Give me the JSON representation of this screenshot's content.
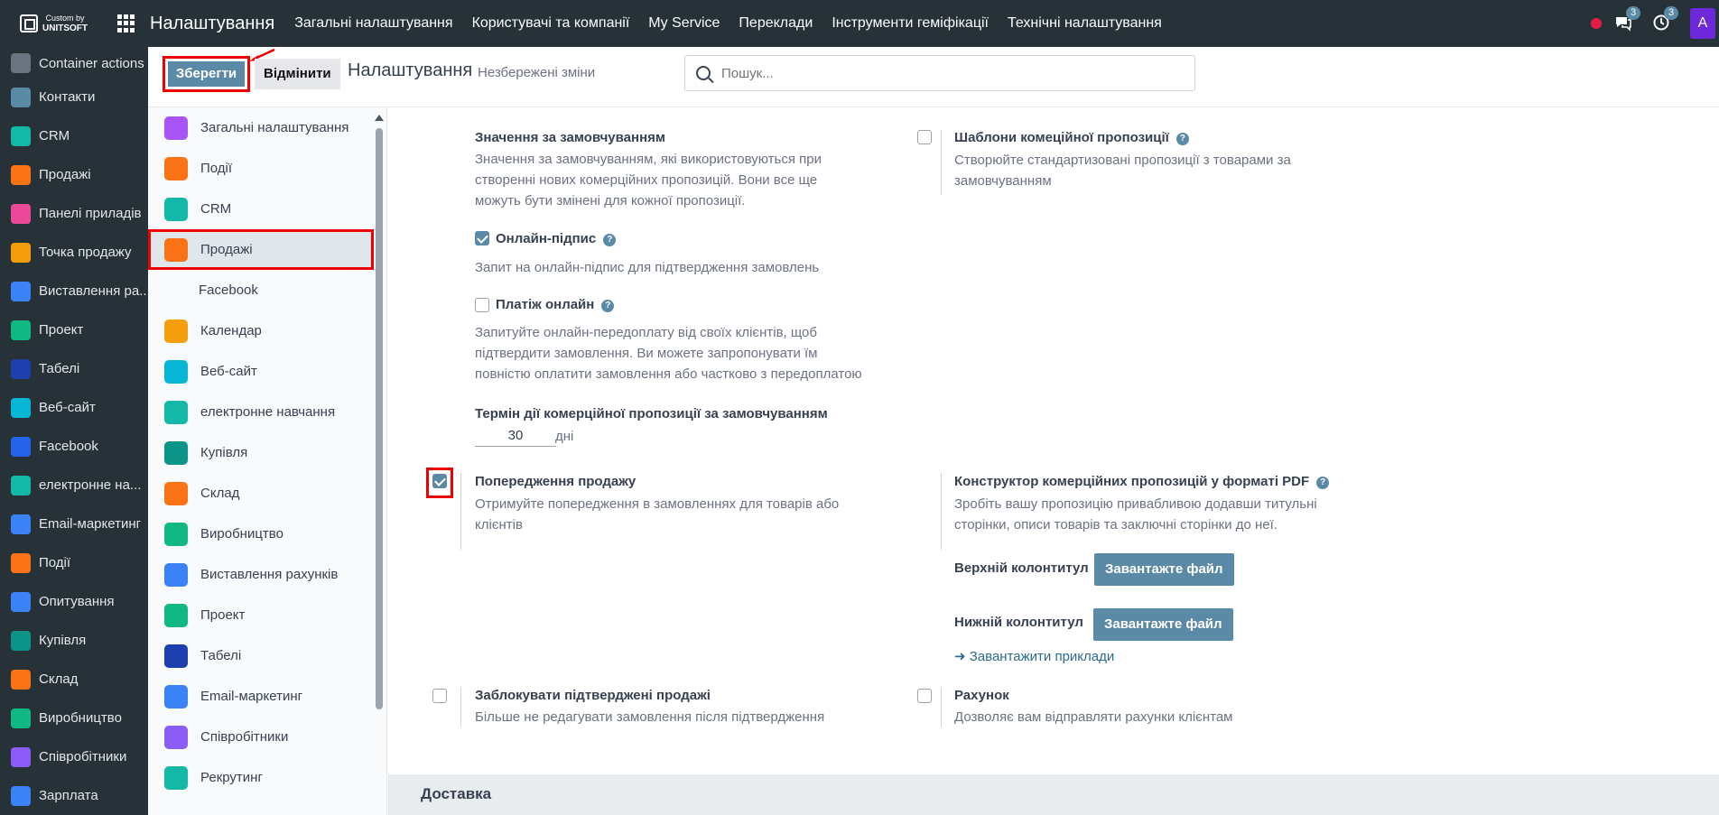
{
  "topbar": {
    "brand_small": "Custom by",
    "brand_name": "UNITSOFT",
    "app_title": "Налаштування",
    "menu": [
      "Загальні налаштування",
      "Користувачі та компанії",
      "My Service",
      "Переклади",
      "Інструменти геміфікації",
      "Технічні налаштування"
    ],
    "chat_badge": "3",
    "activity_badge": "3",
    "avatar_letter": "A"
  },
  "apps_sidebar": [
    {
      "label": "Container actions",
      "icon": "container-icon",
      "color": "#6b7280"
    },
    {
      "label": "Контакти",
      "icon": "contacts-icon",
      "color": "#5b8aa6"
    },
    {
      "label": "CRM",
      "icon": "crm-icon",
      "color": "#14b8a6"
    },
    {
      "label": "Продажі",
      "icon": "sales-icon",
      "color": "#f97316"
    },
    {
      "label": "Панелі приладів",
      "icon": "dashboard-icon",
      "color": "#ec4899"
    },
    {
      "label": "Точка продажу",
      "icon": "pos-icon",
      "color": "#f59e0b"
    },
    {
      "label": "Виставлення ра...",
      "icon": "invoicing-icon",
      "color": "#3b82f6"
    },
    {
      "label": "Проект",
      "icon": "project-icon",
      "color": "#10b981"
    },
    {
      "label": "Табелі",
      "icon": "timesheet-icon",
      "color": "#1e40af"
    },
    {
      "label": "Веб-сайт",
      "icon": "website-icon",
      "color": "#06b6d4"
    },
    {
      "label": "Facebook",
      "icon": "facebook-icon",
      "color": "#2563eb"
    },
    {
      "label": "електронне на...",
      "icon": "elearning-icon",
      "color": "#14b8a6"
    },
    {
      "label": "Email-маркетинг",
      "icon": "email-marketing-icon",
      "color": "#3b82f6"
    },
    {
      "label": "Події",
      "icon": "events-icon",
      "color": "#f97316"
    },
    {
      "label": "Опитування",
      "icon": "survey-icon",
      "color": "#3b82f6"
    },
    {
      "label": "Купівля",
      "icon": "purchase-icon",
      "color": "#0d9488"
    },
    {
      "label": "Склад",
      "icon": "inventory-icon",
      "color": "#f97316"
    },
    {
      "label": "Виробництво",
      "icon": "manufacturing-icon",
      "color": "#10b981"
    },
    {
      "label": "Співробітники",
      "icon": "employees-icon",
      "color": "#8b5cf6"
    },
    {
      "label": "Зарплата",
      "icon": "payroll-icon",
      "color": "#3b82f6"
    }
  ],
  "control": {
    "save_label": "Зберегти",
    "discard_label": "Відмінити",
    "breadcrumb": "Налаштування",
    "unsaved": "Незбережені зміни",
    "search_placeholder": "Пошук..."
  },
  "settings_nav": [
    {
      "label": "Загальні налаштування",
      "icon": "general-settings-icon",
      "color": "#a855f7"
    },
    {
      "label": "Події",
      "icon": "events-icon",
      "color": "#f97316"
    },
    {
      "label": "CRM",
      "icon": "crm-icon",
      "color": "#14b8a6"
    },
    {
      "label": "Продажі",
      "icon": "sales-icon",
      "color": "#f97316",
      "active": true
    },
    {
      "label": "Facebook",
      "icon": "",
      "color": "",
      "sub": true
    },
    {
      "label": "Календар",
      "icon": "calendar-icon",
      "color": "#f59e0b"
    },
    {
      "label": "Веб-сайт",
      "icon": "website-icon",
      "color": "#06b6d4"
    },
    {
      "label": "електронне навчання",
      "icon": "elearning-icon",
      "color": "#14b8a6"
    },
    {
      "label": "Купівля",
      "icon": "purchase-icon",
      "color": "#0d9488"
    },
    {
      "label": "Склад",
      "icon": "inventory-icon",
      "color": "#f97316"
    },
    {
      "label": "Виробництво",
      "icon": "manufacturing-icon",
      "color": "#10b981"
    },
    {
      "label": "Виставлення рахунків",
      "icon": "invoicing-icon",
      "color": "#3b82f6"
    },
    {
      "label": "Проект",
      "icon": "project-icon",
      "color": "#10b981"
    },
    {
      "label": "Табелі",
      "icon": "timesheet-icon",
      "color": "#1e40af"
    },
    {
      "label": "Email-маркетинг",
      "icon": "email-marketing-icon",
      "color": "#3b82f6"
    },
    {
      "label": "Співробітники",
      "icon": "employees-icon",
      "color": "#8b5cf6"
    },
    {
      "label": "Рекрутинг",
      "icon": "recruitment-icon",
      "color": "#14b8a6"
    }
  ],
  "settings": {
    "defaults_title": "Значення за замовчуванням",
    "defaults_desc": [
      "Значення за замовчуванням, які використовуються при",
      "створенні нових комерційних пропозицій. Вони все ще",
      "можуть бути змінені для кожної пропозиції."
    ],
    "online_sign_label": "Онлайн-підпис",
    "online_sign_checked": true,
    "online_sign_desc": "Запит на онлайн-підпис для підтвердження замовлень",
    "online_pay_label": "Платіж онлайн",
    "online_pay_checked": false,
    "online_pay_desc": [
      "Запитуйте онлайн-передоплату від своїх клієнтів, щоб",
      "підтвердити замовлення. Ви можете запропонувати їм",
      "повністю оплатити замовлення або частково з передоплатою"
    ],
    "validity_title": "Термін дії комерційної пропозиції за замовчуванням",
    "validity_value": "30",
    "validity_unit": "дні",
    "templates_title": "Шаблони комеційної пропозиції",
    "templates_checked": false,
    "templates_desc": [
      "Створюйте стандартизовані пропозиції з товарами за",
      "замовчуванням"
    ],
    "warnings_title": "Попередження продажу",
    "warnings_checked": true,
    "warnings_desc": [
      "Отримуйте попередження в замовленнях для товарів або",
      "клієнтів"
    ],
    "pdf_title": "Конструктор комерційних пропозицій у форматі PDF",
    "pdf_desc": [
      "Зробіть вашу пропозицію привабливою додавши титульні",
      "сторінки, описи товарів та заключні сторінки до неї."
    ],
    "header_label": "Верхній колонтитул",
    "footer_label": "Нижній колонтитул",
    "upload_label": "Завантажте файл",
    "examples_link": "Завантажити приклади",
    "lock_title": "Заблокувати підтверджені продажі",
    "lock_checked": false,
    "lock_desc": "Більше не редагувати замовлення після підтвердження",
    "invoice_title": "Рахунок",
    "invoice_checked": false,
    "invoice_desc": "Дозволяє вам відправляти рахунки клієнтам",
    "section_delivery": "Доставка"
  },
  "colors": {
    "topbar": "#263238",
    "primary": "#5b8aa6",
    "highlight": "#e00000"
  }
}
